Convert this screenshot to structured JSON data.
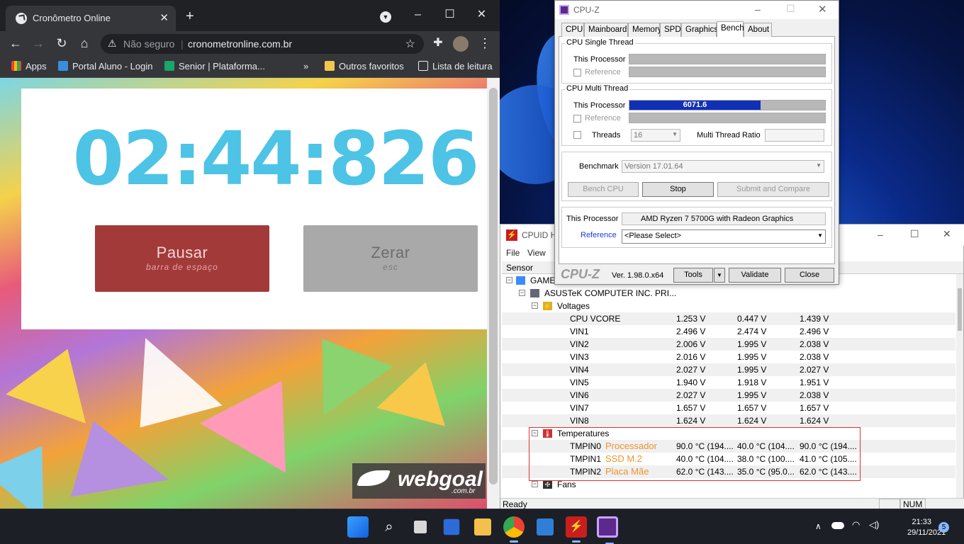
{
  "browser": {
    "tab_title": "Cronômetro Online",
    "new_tab": "+",
    "security_label": "Não seguro",
    "url": "cronometronline.com.br",
    "bookmarks": [
      "Apps",
      "Portal Aluno - Login",
      "Senior | Plataforma...",
      "»",
      "Outros favoritos",
      "Lista de leitura"
    ]
  },
  "stopwatch": {
    "time": "02:44:826",
    "pause_label": "Pausar",
    "pause_hint": "barra de espaço",
    "reset_label": "Zerar",
    "reset_hint": "esc",
    "logo_text": "webgoal",
    "logo_sub": ".com.br"
  },
  "cpuz": {
    "title": "CPU-Z",
    "tabs": [
      "CPU",
      "Mainboard",
      "Memory",
      "SPD",
      "Graphics",
      "Bench",
      "About"
    ],
    "active_tab": "Bench",
    "single_thread": {
      "title": "CPU Single Thread",
      "this_processor": "This Processor",
      "reference": "Reference"
    },
    "multi_thread": {
      "title": "CPU Multi Thread",
      "this_processor": "This Processor",
      "score": "6071.6",
      "progress": 0.67,
      "reference": "Reference",
      "threads_label": "Threads",
      "threads_value": "16",
      "ratio_label": "Multi Thread Ratio"
    },
    "benchmark_label": "Benchmark",
    "benchmark_version": "Version 17.01.64",
    "bench_cpu": "Bench CPU",
    "stop": "Stop",
    "submit": "Submit and Compare",
    "this_processor_label": "This Processor",
    "processor_name": "AMD Ryzen 7 5700G with Radeon Graphics",
    "reference_label": "Reference",
    "reference_select": "<Please Select>",
    "footer_logo": "CPU-Z",
    "version": "Ver. 1.98.0.x64",
    "tools": "Tools",
    "validate": "Validate",
    "close": "Close"
  },
  "hwinfo": {
    "title": "CPUID H",
    "menu": [
      "File",
      "View"
    ],
    "column_sensor": "Sensor",
    "root": "GAME",
    "board": "ASUSTeK COMPUTER INC. PRI...",
    "voltages_label": "Voltages",
    "voltages": [
      {
        "name": "CPU VCORE",
        "v": "1.253 V",
        "min": "0.447 V",
        "max": "1.439 V"
      },
      {
        "name": "VIN1",
        "v": "2.496 V",
        "min": "2.474 V",
        "max": "2.496 V"
      },
      {
        "name": "VIN2",
        "v": "2.006 V",
        "min": "1.995 V",
        "max": "2.038 V"
      },
      {
        "name": "VIN3",
        "v": "2.016 V",
        "min": "1.995 V",
        "max": "2.038 V"
      },
      {
        "name": "VIN4",
        "v": "2.027 V",
        "min": "1.995 V",
        "max": "2.027 V"
      },
      {
        "name": "VIN5",
        "v": "1.940 V",
        "min": "1.918 V",
        "max": "1.951 V"
      },
      {
        "name": "VIN6",
        "v": "2.027 V",
        "min": "1.995 V",
        "max": "2.038 V"
      },
      {
        "name": "VIN7",
        "v": "1.657 V",
        "min": "1.657 V",
        "max": "1.657 V"
      },
      {
        "name": "VIN8",
        "v": "1.624 V",
        "min": "1.624 V",
        "max": "1.624 V"
      }
    ],
    "temperatures_label": "Temperatures",
    "temperatures": [
      {
        "name": "TMPIN0",
        "note": "Processador",
        "v": "90.0 °C (194....",
        "min": "40.0 °C (104....",
        "max": "90.0 °C (194...."
      },
      {
        "name": "TMPIN1",
        "note": "SSD M.2",
        "v": "40.0 °C (104....",
        "min": "38.0 °C (100....",
        "max": "41.0 °C (105...."
      },
      {
        "name": "TMPIN2",
        "note": "Placa Mãe",
        "v": "62.0 °C (143....",
        "min": "35.0 °C (95.0...",
        "max": "62.0 °C (143...."
      }
    ],
    "fans_label": "Fans",
    "status": "Ready",
    "num": "NUM"
  },
  "taskbar": {
    "time": "21:33",
    "date": "29/11/2021",
    "notifications": "5"
  }
}
